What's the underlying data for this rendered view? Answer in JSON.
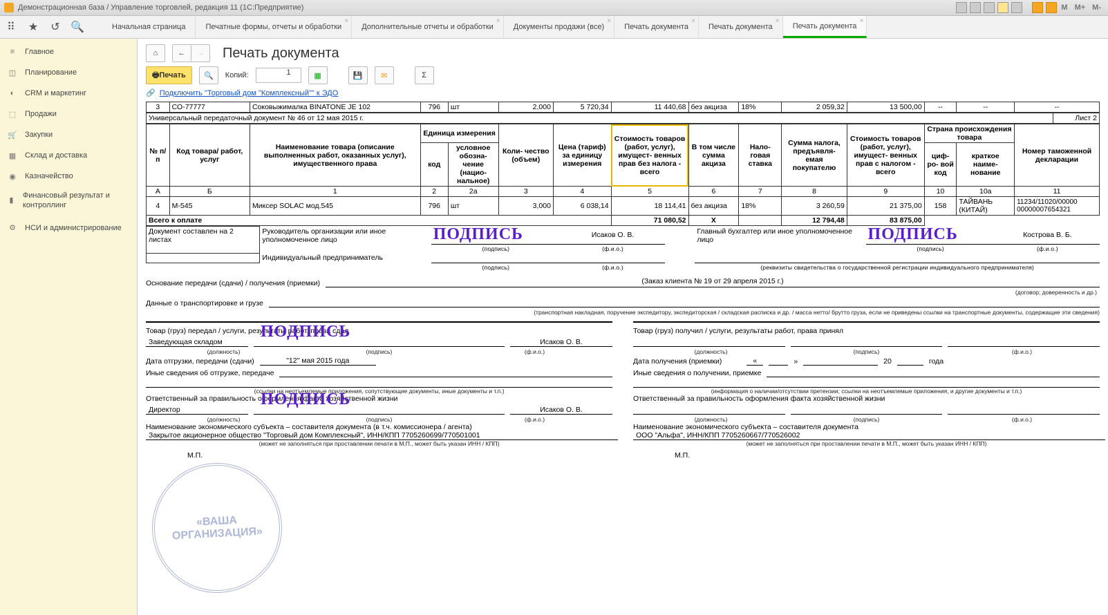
{
  "window_title": "Демонстрационная база / Управление торговлей, редакция 11  (1С:Предприятие)",
  "tray": {
    "m": "M",
    "mplus": "M+",
    "mminus": "M-"
  },
  "tabs": [
    {
      "label": "Начальная страница"
    },
    {
      "label": "Печатные формы, отчеты и обработки"
    },
    {
      "label": "Дополнительные отчеты и обработки"
    },
    {
      "label": "Документы продажи (все)"
    },
    {
      "label": "Печать документа"
    },
    {
      "label": "Печать документа"
    },
    {
      "label": "Печать документа",
      "active": true
    }
  ],
  "sidebar": [
    "Главное",
    "Планирование",
    "CRM и маркетинг",
    "Продажи",
    "Закупки",
    "Склад и доставка",
    "Казначейство",
    "Финансовый результат и контроллинг",
    "НСИ и администрирование"
  ],
  "page": {
    "title": "Печать документа",
    "print": "Печать",
    "copies_label": "Копий:",
    "copies_value": "1",
    "link": "Подключить \"Торговый дом \"Комплексный\"\" к ЭДО"
  },
  "row3": {
    "n": "3",
    "code": "СО-77777",
    "name": "Соковыжималка  BINATONE JE 102",
    "unit_code": "796",
    "unit": "шт",
    "qty": "2,000",
    "price": "5 720,34",
    "sum_no_tax": "11 440,68",
    "excise": "без акциза",
    "rate": "18%",
    "tax": "2 059,32",
    "sum_tax": "13 500,00",
    "dash1": "--",
    "dash2": "--",
    "dash3": "--"
  },
  "page_header": {
    "upd": "Универсальный передаточный документ № 46 от 12 мая 2015 г.",
    "sheet": "Лист 2"
  },
  "thead": {
    "n": "№ п/п",
    "code": "Код товара/ работ, услуг",
    "name": "Наименование товара (описание выполненных работ, оказанных услуг), имущественного права",
    "unit_group": "Единица измерения",
    "unit_code": "код",
    "unit_name": "условное обозна- чение (нацио- нальное)",
    "qty": "Коли- чество (объем)",
    "price": "Цена (тариф) за единицу измерения",
    "sum_no_tax": "Стоимость товаров (работ, услуг), имущест- венных прав без налога - всего",
    "excise": "В том числе сумма акциза",
    "rate": "Нало- говая ставка",
    "tax": "Сумма налога, предъявля- емая покупателю",
    "sum_tax": "Стоимость товаров (работ, услуг), имущест- венных прав с налогом - всего",
    "country_group": "Страна происхождения товара",
    "country_code": "циф- ро- вой код",
    "country_name": "краткое наиме- нование",
    "decl": "Номер таможенной декларации",
    "cols": {
      "A": "А",
      "B": "Б",
      "1": "1",
      "2": "2",
      "2a": "2а",
      "3": "3",
      "4": "4",
      "5": "5",
      "6": "6",
      "7": "7",
      "8": "8",
      "9": "9",
      "10": "10",
      "10a": "10а",
      "11": "11"
    }
  },
  "row4": {
    "n": "4",
    "code": "М-545",
    "name": "Миксер SOLAC мод.545",
    "unit_code": "796",
    "unit": "шт",
    "qty": "3,000",
    "price": "6 038,14",
    "sum_no_tax": "18 114,41",
    "excise": "без акциза",
    "rate": "18%",
    "tax": "3 260,59",
    "sum_tax": "21 375,00",
    "country_code": "158",
    "country": "ТАЙВАНЬ (КИТАЙ)",
    "decl": "11234/11020/00000 00000007654321"
  },
  "totals": {
    "label": "Всего к оплате",
    "sum_no_tax": "71 080,52",
    "excise": "Х",
    "tax": "12 794,48",
    "sum_tax": "83 875,00"
  },
  "footer": {
    "doc_compiled": "Документ составлен на 2 листах",
    "head_org": "Руководитель организации или иное уполномоченное лицо",
    "ip": "Индивидуальный предприниматель",
    "chief_acc": "Главный бухгалтер или иное уполномоченное лицо",
    "name1": "Исаков О. В.",
    "name2": "Кострова В. Б.",
    "sig_lbl": "(подпись)",
    "fio_lbl": "(ф.и.о.)",
    "ip_req": "(реквизиты свидетельства о государственной  регистрации индивидуального предпринимателя)",
    "basis_lbl": "Основание передачи (сдачи) / получения (приемки)",
    "basis_val": "(Заказ клиента № 19 от 29 апреля 2015 г.)",
    "basis_hint": "(договор; доверенность и др.)",
    "transport_lbl": "Данные о транспортировке и грузе",
    "transport_hint": "(транспортная накладная, поручение экспедитору, экспедиторская / складская расписка и др. / масса нетто/ брутто груза, если не приведены ссылки на транспортные документы, содержащие эти сведения)",
    "left": {
      "transfer": "Товар (груз) передал / услуги, результаты работ, права сдал",
      "post": "Заведующая складом",
      "name": "Исаков О. В.",
      "date_lbl": "Дата отгрузки, передачи (сдачи)",
      "date_val": "\"12\" мая 2015 года",
      "other": "Иные сведения об отгрузке, передаче",
      "other_hint": "(ссылки на неотъемлемые приложения, сопутствующие документы, иные документы и т.п.)",
      "resp": "Ответственный за правильность оформления факта хозяйственной жизни",
      "resp_post": "Директор",
      "resp_name": "Исаков О. В.",
      "subj_lbl": "Наименование экономического субъекта – составителя документа (в т.ч. комиссионера / агента)",
      "subj_val": "Закрытое акционерное общество \"Торговый дом Комплексный\", ИНН/КПП 7705260699/770501001",
      "subj_hint": "(может не заполняться при проставлении печати в М.П., может быть указан ИНН / КПП)",
      "mp": "М.П."
    },
    "right": {
      "receive": "Товар (груз) получил / услуги, результаты работ, права принял",
      "date_lbl": "Дата получения (приемки)",
      "date_a": "«",
      "date_b": "»",
      "date_yr": "20",
      "date_g": "года",
      "other": "Иные сведения о получении, приемке",
      "other_hint": "(информация о наличии/отсутствии претензии; ссылки на неотъемлемые приложения, и другие  документы и т.п.)",
      "resp": "Ответственный за правильность оформления факта хозяйственной жизни",
      "subj_lbl": "Наименование экономического субъекта – составителя документа",
      "subj_val": "ООО \"Альфа\", ИНН/КПП 7705260667/770526002",
      "subj_hint": "(может не заполняться при проставлении печати в М.П., может быть указан ИНН / КПП)",
      "mp": "М.П."
    },
    "post_lbl": "(должность)",
    "sign_word": "ПОДПИСЬ",
    "stamp_line1": "«ВАША",
    "stamp_line2": "ОРГАНИЗАЦИЯ»"
  }
}
